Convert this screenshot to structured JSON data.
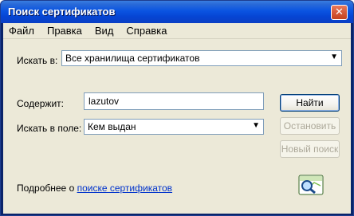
{
  "window": {
    "title": "Поиск сертификатов",
    "close_glyph": "✕"
  },
  "menu": [
    {
      "label": "Файл"
    },
    {
      "label": "Правка"
    },
    {
      "label": "Вид"
    },
    {
      "label": "Справка"
    }
  ],
  "search_in": {
    "label": "Искать в:",
    "value": "Все хранилища сертификатов"
  },
  "contains": {
    "label": "Содержит:",
    "value": "lazutov"
  },
  "search_field": {
    "label": "Искать в поле:",
    "value": "Кем выдан"
  },
  "buttons": {
    "find": "Найти",
    "stop": "Остановить",
    "new_search": "Новый поиск"
  },
  "footer": {
    "text": "Подробнее о ",
    "link": "поиске сертификатов"
  },
  "icons": {
    "dropdown": "chevron-down-icon",
    "search": "magnifier-search-icon",
    "close": "close-icon"
  }
}
